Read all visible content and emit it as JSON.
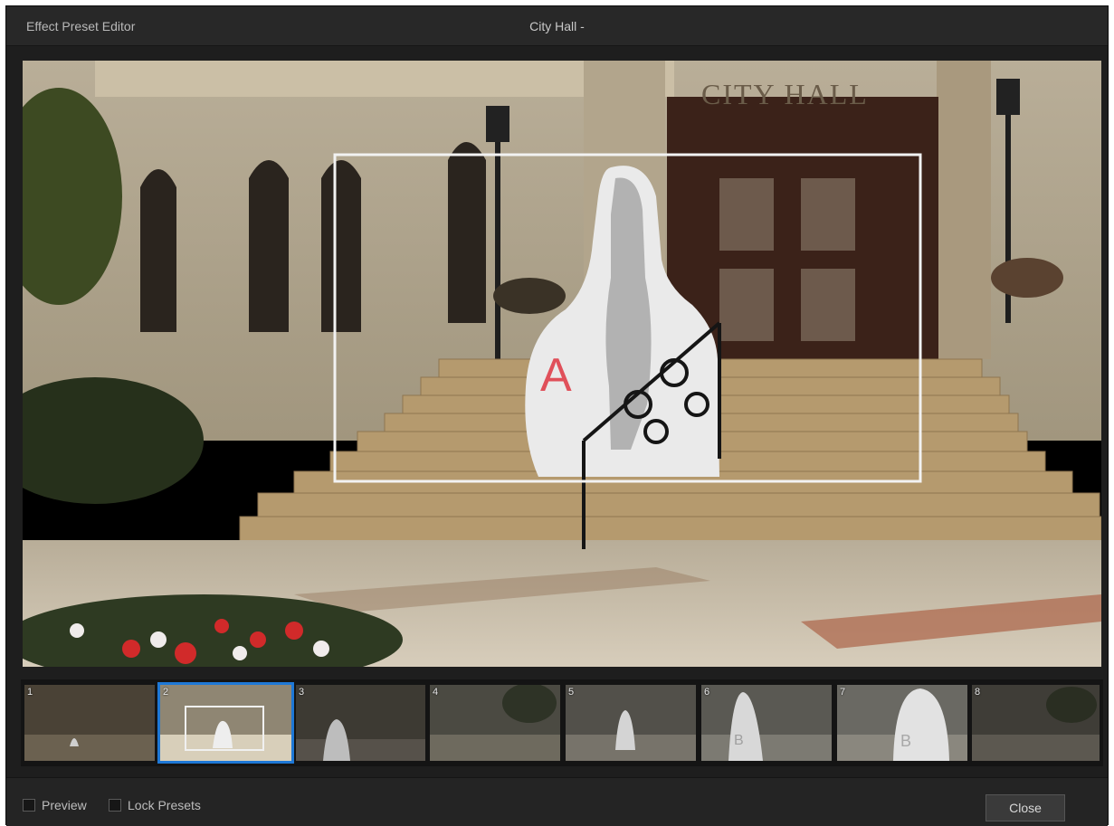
{
  "window": {
    "app_title": "Effect Preset Editor",
    "doc_title": "City Hall -"
  },
  "viewer": {
    "building_sign": "CITY HALL",
    "overlay_label": "A",
    "overlay_label_color": "#e0505a"
  },
  "thumbnails": [
    {
      "number": "1",
      "selected": false,
      "label": ""
    },
    {
      "number": "2",
      "selected": true,
      "label": ""
    },
    {
      "number": "3",
      "selected": false,
      "label": ""
    },
    {
      "number": "4",
      "selected": false,
      "label": ""
    },
    {
      "number": "5",
      "selected": false,
      "label": ""
    },
    {
      "number": "6",
      "selected": false,
      "label": "B"
    },
    {
      "number": "7",
      "selected": false,
      "label": "B"
    },
    {
      "number": "8",
      "selected": false,
      "label": ""
    }
  ],
  "footer": {
    "preview_label": "Preview",
    "lock_presets_label": "Lock Presets",
    "close_label": "Close"
  },
  "colors": {
    "selection_accent": "#1e78d6",
    "window_bg": "#1e1e1e"
  }
}
